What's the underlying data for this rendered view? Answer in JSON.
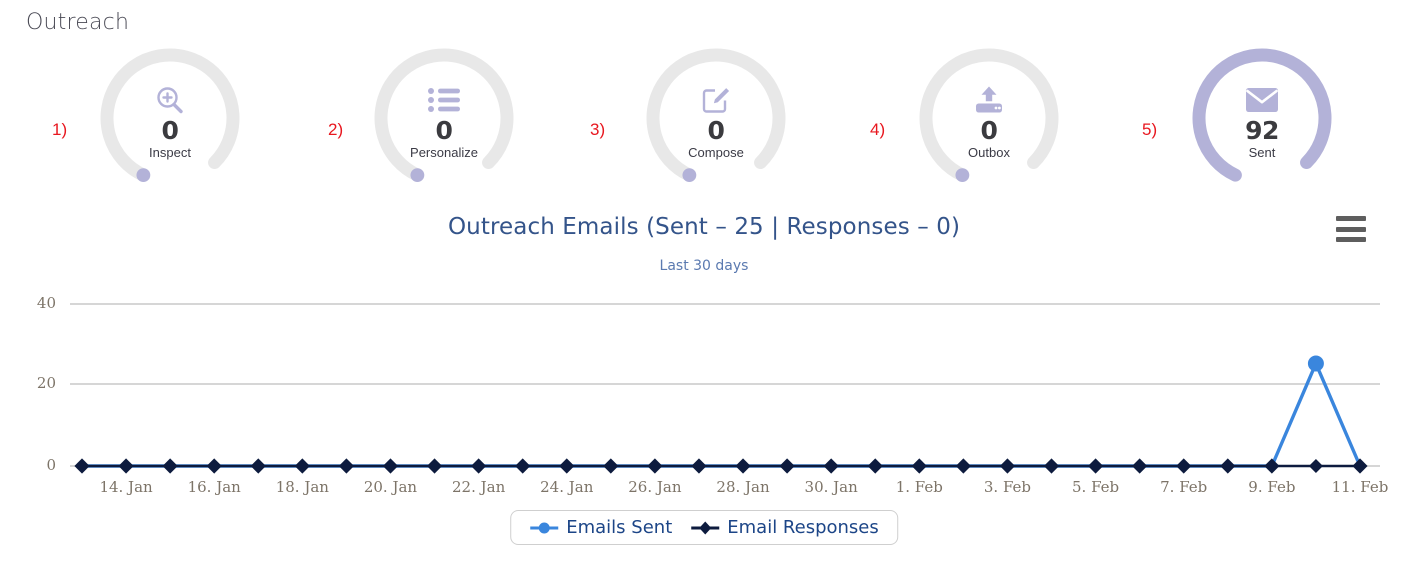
{
  "page": {
    "title": "Outreach",
    "title_color": "#4a4a55",
    "step_color": "#e8171f",
    "accent_purple": "#b3b2d8",
    "ring_gray": "#e8e8e8"
  },
  "gauges": [
    {
      "step": "1)",
      "icon": "magnifier-plus-icon",
      "value": "0",
      "label": "Inspect",
      "filled": false
    },
    {
      "step": "2)",
      "icon": "list-icon",
      "value": "0",
      "label": "Personalize",
      "filled": false
    },
    {
      "step": "3)",
      "icon": "compose-pencil-icon",
      "value": "0",
      "label": "Compose",
      "filled": false
    },
    {
      "step": "4)",
      "icon": "outbox-upload-icon",
      "value": "0",
      "label": "Outbox",
      "filled": false
    },
    {
      "step": "5)",
      "icon": "envelope-icon",
      "value": "92",
      "label": "Sent",
      "filled": true
    }
  ],
  "menu": {
    "name": "chart-context-menu",
    "label": "Chart menu"
  },
  "chart_data": {
    "type": "line",
    "title": "Outreach Emails (Sent – 25 | Responses – 0)",
    "subtitle": "Last 30 days",
    "xlabel": "",
    "ylabel": "",
    "ylim": [
      0,
      40
    ],
    "yticks": [
      0,
      20,
      40
    ],
    "ytick_labels": [
      "0",
      "20",
      "40"
    ],
    "grid": true,
    "legend_position": "bottom",
    "x": [
      "13. Jan",
      "14. Jan",
      "15. Jan",
      "16. Jan",
      "17. Jan",
      "18. Jan",
      "19. Jan",
      "20. Jan",
      "21. Jan",
      "22. Jan",
      "23. Jan",
      "24. Jan",
      "25. Jan",
      "26. Jan",
      "27. Jan",
      "28. Jan",
      "29. Jan",
      "30. Jan",
      "31. Jan",
      "1. Feb",
      "2. Feb",
      "3. Feb",
      "4. Feb",
      "5. Feb",
      "6. Feb",
      "7. Feb",
      "8. Feb",
      "9. Feb",
      "10. Feb",
      "11. Feb"
    ],
    "xtick_labels": [
      "14. Jan",
      "16. Jan",
      "18. Jan",
      "20. Jan",
      "22. Jan",
      "24. Jan",
      "26. Jan",
      "28. Jan",
      "30. Jan",
      "1. Feb",
      "3. Feb",
      "5. Feb",
      "7. Feb",
      "9. Feb",
      "11. Feb"
    ],
    "series": [
      {
        "name": "Emails Sent",
        "color": "#3a86dd",
        "marker": "circle",
        "values": [
          0,
          0,
          0,
          0,
          0,
          0,
          0,
          0,
          0,
          0,
          0,
          0,
          0,
          0,
          0,
          0,
          0,
          0,
          0,
          0,
          0,
          0,
          0,
          0,
          0,
          0,
          0,
          0,
          25,
          0
        ]
      },
      {
        "name": "Email Responses",
        "color": "#0d1b3e",
        "marker": "diamond",
        "values": [
          0,
          0,
          0,
          0,
          0,
          0,
          0,
          0,
          0,
          0,
          0,
          0,
          0,
          0,
          0,
          0,
          0,
          0,
          0,
          0,
          0,
          0,
          0,
          0,
          0,
          0,
          0,
          0,
          0,
          0
        ]
      }
    ]
  }
}
